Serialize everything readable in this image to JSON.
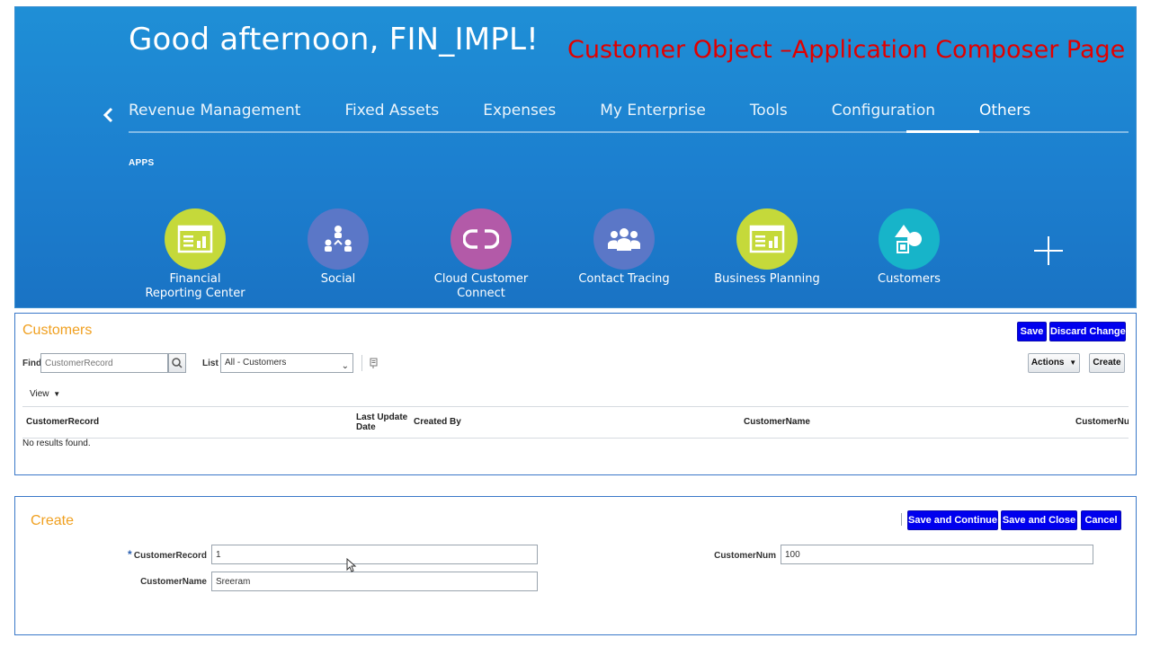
{
  "banner": {
    "greeting": "Good afternoon, FIN_IMPL!",
    "overlay_title": "Customer Object –Application Composer Page",
    "nav_items": [
      "Revenue Management",
      "Fixed Assets",
      "Expenses",
      "My Enterprise",
      "Tools",
      "Configuration",
      "Others"
    ],
    "active_nav": "Others",
    "apps_label": "APPS",
    "apps": [
      {
        "line1": "Financial",
        "line2": "Reporting Center",
        "icon": "report-icon",
        "color": "#c5d93a"
      },
      {
        "line1": "Social",
        "line2": "",
        "icon": "social-network-icon",
        "color": "#5b77c7"
      },
      {
        "line1": "Cloud Customer",
        "line2": "Connect",
        "icon": "connect-icon",
        "color": "#b35aa8"
      },
      {
        "line1": "Contact Tracing",
        "line2": "",
        "icon": "people-group-icon",
        "color": "#5b77c7"
      },
      {
        "line1": "Business Planning",
        "line2": "",
        "icon": "report-icon",
        "color": "#c5d93a"
      },
      {
        "line1": "Customers",
        "line2": "",
        "icon": "shapes-icon",
        "color": "#17b4c9"
      }
    ]
  },
  "customers": {
    "title": "Customers",
    "save": "Save",
    "discard": "Discard Changes",
    "find_label": "Find",
    "find_placeholder": "CustomerRecord",
    "list_label": "List",
    "list_value": "All - Customers",
    "actions": "Actions",
    "create": "Create",
    "view": "View",
    "columns": [
      "CustomerRecord",
      "Last Update",
      "Date",
      "Created By",
      "CustomerName",
      "CustomerNu"
    ],
    "empty_message": "No results found."
  },
  "create": {
    "title": "Create",
    "save_continue": "Save and Continue",
    "save_close": "Save and Close",
    "cancel": "Cancel",
    "required_mark": "*",
    "fields": {
      "customer_record_label": "CustomerRecord",
      "customer_record_value": "1",
      "customer_name_label": "CustomerName",
      "customer_name_value": "Sreeram",
      "customer_num_label": "CustomerNum",
      "customer_num_value": "100"
    }
  },
  "colors": {
    "banner_blue": "#1c7fcf",
    "button_blue": "#0000ee",
    "title_orange": "#f0a020",
    "overlay_red": "#e00000"
  }
}
